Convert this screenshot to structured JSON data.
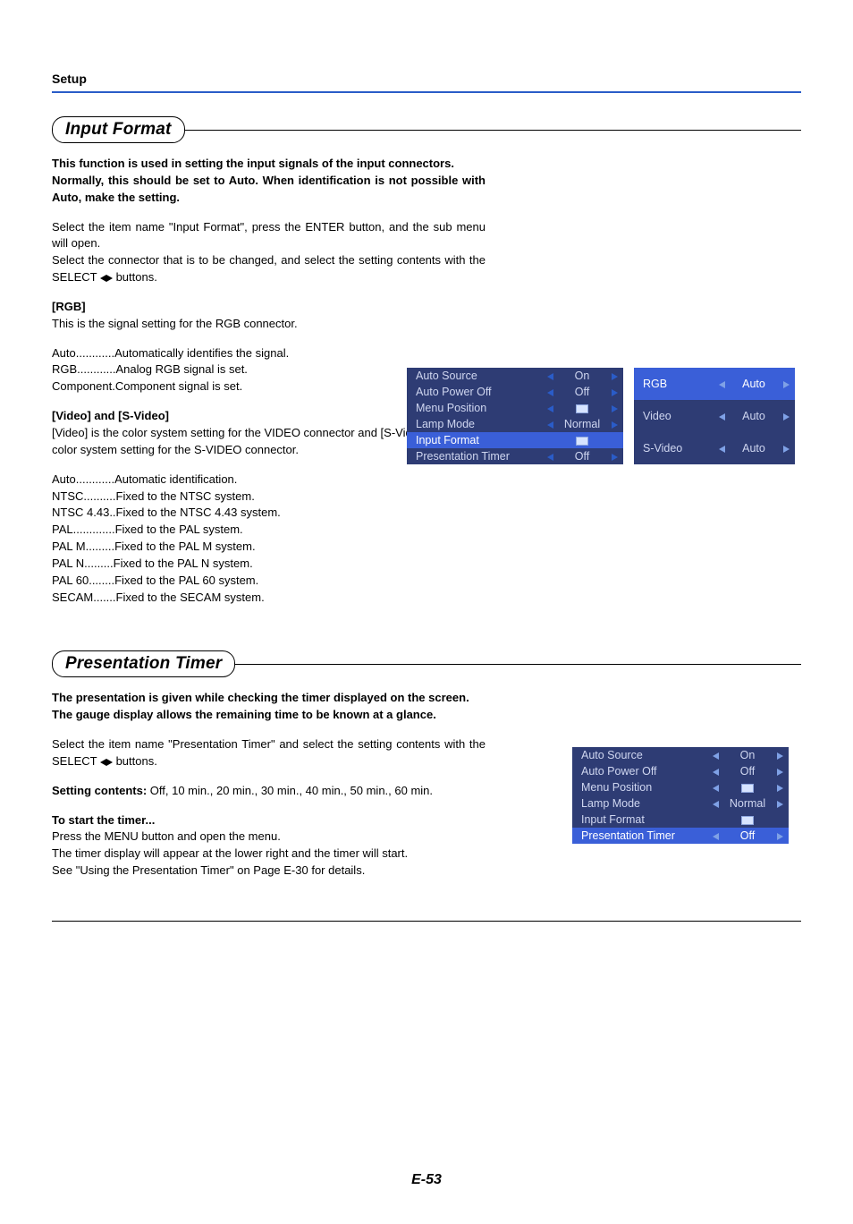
{
  "header": {
    "setup": "Setup"
  },
  "sec1": {
    "title": "Input Format",
    "intro1": "This function is used in setting the input signals of the input connectors.",
    "intro2": "Normally, this should be set to Auto. When identification is not possible with Auto, make the setting.",
    "p1": "Select the item name \"Input Format\", press the ENTER button, and the sub menu will open.",
    "p2a": "Select the connector that is to be changed, and select the setting contents with the SELECT ",
    "p2b": " buttons.",
    "rgb_h": "[RGB]",
    "rgb_p": "This is the signal setting for the RGB connector.",
    "rgb_defs": [
      {
        "k": "Auto ",
        "d": "............ ",
        "v": "Automatically identifies the signal."
      },
      {
        "k": "RGB ",
        "d": "............ ",
        "v": "Analog RGB signal is set."
      },
      {
        "k": "Component ",
        "d": ". ",
        "v": "Component signal is set."
      }
    ],
    "vid_h": "[Video] and [S-Video]",
    "vid_p": "[Video] is the color system setting for the VIDEO connector and [S-Video] is the color system setting for the S-VIDEO connector.",
    "vid_defs": [
      {
        "k": "Auto ",
        "d": "............ ",
        "v": "Automatic identification."
      },
      {
        "k": "NTSC ",
        "d": ".......... ",
        "v": "Fixed to the NTSC system."
      },
      {
        "k": "NTSC 4.43 ",
        "d": ".. ",
        "v": "Fixed to the NTSC 4.43 system."
      },
      {
        "k": "PAL ",
        "d": "............. ",
        "v": "Fixed to the PAL system."
      },
      {
        "k": "PAL M ",
        "d": "......... ",
        "v": "Fixed to the PAL M system."
      },
      {
        "k": "PAL N ",
        "d": "......... ",
        "v": "Fixed to the PAL N system."
      },
      {
        "k": "PAL 60 ",
        "d": "........ ",
        "v": "Fixed to the PAL 60 system."
      },
      {
        "k": "SECAM ",
        "d": "....... ",
        "v": "Fixed to the SECAM system."
      }
    ]
  },
  "sec2": {
    "title": "Presentation Timer",
    "intro1": "The presentation is given while checking the timer displayed on the screen.",
    "intro2": "The gauge display allows the remaining time to be known at a glance.",
    "p1a": "Select the item name \"Presentation Timer\" and select the setting contents with the SELECT ",
    "p1b": " buttons.",
    "sc_label": "Setting contents:",
    "sc_val": " Off, 10 min., 20 min., 30 min., 40 min., 50 min., 60 min.",
    "start_h": "To start the timer...",
    "start_p1": "Press the MENU button and open the menu.",
    "start_p2": "The timer display will appear at the lower right and the timer will start.",
    "start_p3": "See \"Using the Presentation Timer\" on Page E-30 for details."
  },
  "menu1": {
    "rows": [
      {
        "name": "Auto Source",
        "val": "On",
        "arrows": true
      },
      {
        "name": "Auto Power Off",
        "val": "Off",
        "arrows": true
      },
      {
        "name": "Menu Position",
        "val": "icon",
        "arrows": true
      },
      {
        "name": "Lamp Mode",
        "val": "Normal",
        "arrows": true
      },
      {
        "name": "Input Format",
        "val": "icon",
        "arrows": false,
        "sel": true
      },
      {
        "name": "Presentation Timer",
        "val": "Off",
        "arrows": true
      }
    ],
    "side": [
      {
        "name": "RGB",
        "val": "Auto",
        "sel": true
      },
      {
        "name": "Video",
        "val": "Auto"
      },
      {
        "name": "S-Video",
        "val": "Auto"
      }
    ]
  },
  "menu2": {
    "rows": [
      {
        "name": "Auto Source",
        "val": "On",
        "arrows": true
      },
      {
        "name": "Auto Power Off",
        "val": "Off",
        "arrows": true
      },
      {
        "name": "Menu Position",
        "val": "icon",
        "arrows": true
      },
      {
        "name": "Lamp Mode",
        "val": "Normal",
        "arrows": true
      },
      {
        "name": "Input Format",
        "val": "icon",
        "arrows": false
      },
      {
        "name": "Presentation Timer",
        "val": "Off",
        "arrows": true,
        "sel": true
      }
    ]
  },
  "footer": {
    "page": "E-53"
  }
}
